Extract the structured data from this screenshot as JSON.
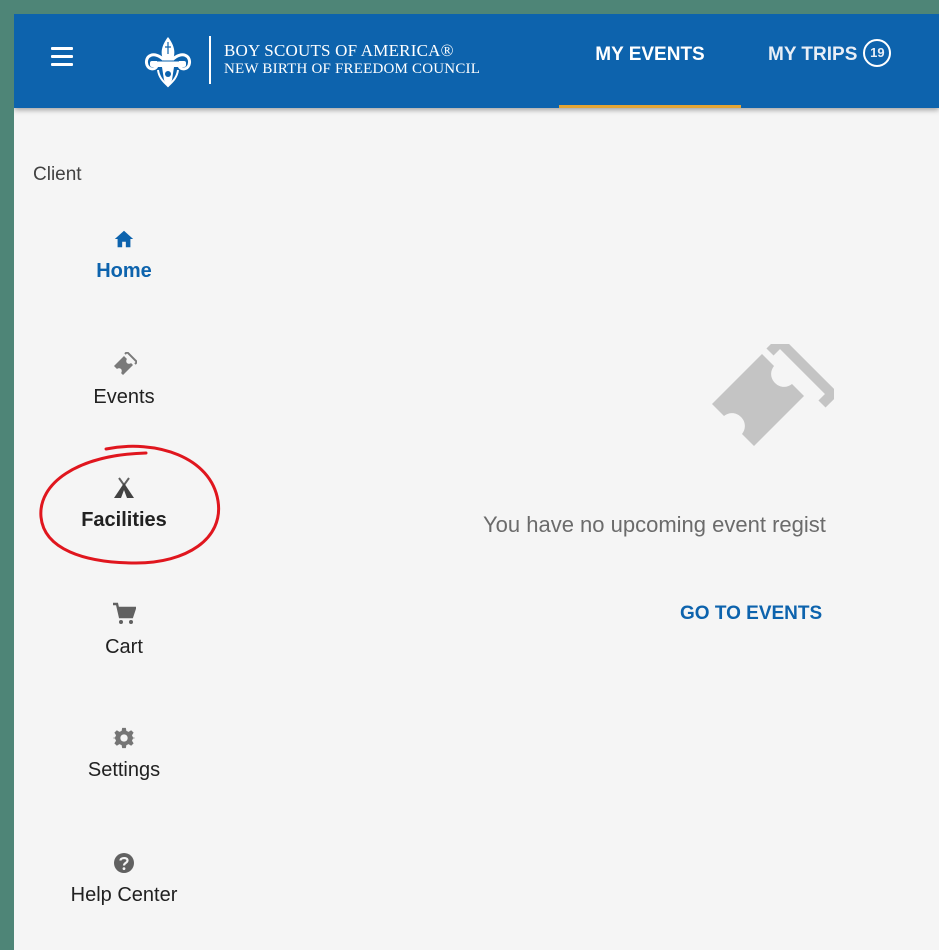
{
  "header": {
    "org_name_line1": "BOY SCOUTS OF AMERICA®",
    "org_name_line2": "NEW BIRTH OF FREEDOM COUNCIL",
    "tabs": [
      {
        "label": "MY EVENTS",
        "active": true
      },
      {
        "label": "MY TRIPS",
        "badge": "19"
      }
    ]
  },
  "sidebar": {
    "section_label": "Client",
    "items": [
      {
        "label": "Home",
        "icon": "home-icon",
        "active": true
      },
      {
        "label": "Events",
        "icon": "ticket-icon"
      },
      {
        "label": "Facilities",
        "icon": "tent-icon",
        "highlighted": true
      },
      {
        "label": "Cart",
        "icon": "cart-icon"
      },
      {
        "label": "Settings",
        "icon": "gear-icon"
      },
      {
        "label": "Help Center",
        "icon": "help-icon"
      }
    ]
  },
  "main": {
    "empty_message": "You have no upcoming event regist",
    "go_to_events_label": "GO TO EVENTS"
  },
  "colors": {
    "header_bg": "#0d63ad",
    "tab_underline": "#e4a534",
    "annotation_circle": "#e0161e",
    "page_bg": "#f5f5f5"
  }
}
